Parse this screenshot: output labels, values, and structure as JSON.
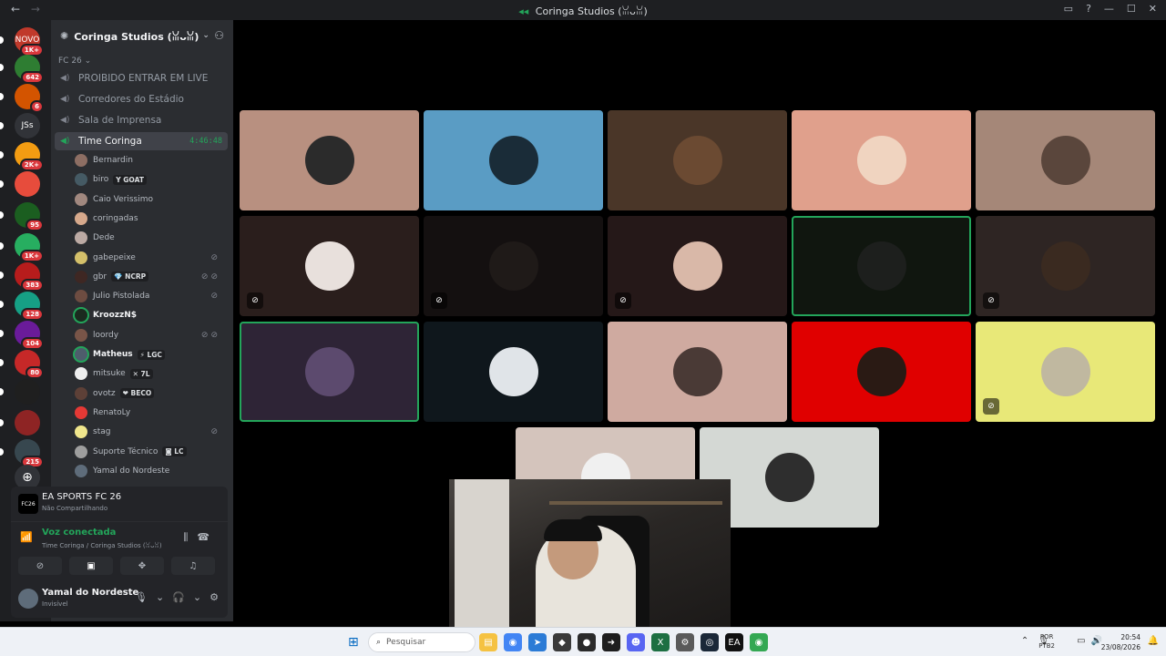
{
  "window": {
    "title": "Coringa Studios (ꈍᴗꈍ)",
    "nav_back": "←",
    "nav_forward": "→"
  },
  "guilds": [
    {
      "label": "NOVO",
      "badge": "1K+",
      "color": "#c0392b"
    },
    {
      "label": "",
      "badge": "642",
      "color": "#2e7d32"
    },
    {
      "label": "",
      "badge": "6",
      "color": "#d35400"
    },
    {
      "label": "JSs",
      "badge": "",
      "color": "#313338"
    },
    {
      "label": "",
      "badge": "2K+",
      "color": "#f39c12"
    },
    {
      "label": "",
      "badge": "",
      "color": "#e74c3c"
    },
    {
      "label": "",
      "badge": "95",
      "color": "#1b5e20"
    },
    {
      "label": "",
      "badge": "1K+",
      "color": "#27ae60"
    },
    {
      "label": "",
      "badge": "383",
      "color": "#b71c1c"
    },
    {
      "label": "",
      "badge": "128",
      "color": "#16a085"
    },
    {
      "label": "",
      "badge": "104",
      "color": "#6a1b9a"
    },
    {
      "label": "",
      "badge": "80",
      "color": "#c62828"
    },
    {
      "label": "",
      "badge": "",
      "color": "#1f1f1f"
    },
    {
      "label": "",
      "badge": "",
      "color": "#8e2424"
    },
    {
      "label": "",
      "badge": "215",
      "color": "#37474f"
    }
  ],
  "server": {
    "name": "Coringa Studios (ꈍᴗꈍ)",
    "category": "FC 26",
    "channels": [
      {
        "name": "PROIBIDO ENTRAR EM LIVE",
        "active": false
      },
      {
        "name": "Corredores do Estádio",
        "active": false
      },
      {
        "name": "Sala de Imprensa",
        "active": false
      },
      {
        "name": "Time Coringa",
        "active": true,
        "timer": "4:46:48"
      }
    ],
    "voice_users": [
      {
        "name": "Bernardin",
        "tag": "",
        "icons": "",
        "bright": false,
        "color": "#8d6e63"
      },
      {
        "name": "biro",
        "tag": "Y GOAT",
        "icons": "",
        "bright": false,
        "color": "#455a64"
      },
      {
        "name": "Caio Verissimo",
        "tag": "",
        "icons": "",
        "bright": false,
        "color": "#a1887f"
      },
      {
        "name": "coringadas",
        "tag": "",
        "icons": "",
        "bright": false,
        "color": "#d7a98c"
      },
      {
        "name": "Dede",
        "tag": "",
        "icons": "",
        "bright": false,
        "color": "#bcaaa4"
      },
      {
        "name": "gabepeixe",
        "tag": "",
        "icons": "⊘",
        "bright": false,
        "color": "#d4c06a"
      },
      {
        "name": "gbr",
        "tag": "💎 NCRP",
        "icons": "⊘⊘",
        "bright": false,
        "color": "#3e2723"
      },
      {
        "name": "Julio Pistolada",
        "tag": "",
        "icons": "⊘",
        "bright": false,
        "color": "#6d4c41"
      },
      {
        "name": "KroozzN$",
        "tag": "",
        "icons": "",
        "bright": true,
        "color": "#1b2a1f",
        "speaking": true
      },
      {
        "name": "loordy",
        "tag": "",
        "icons": "⊘⊘",
        "bright": false,
        "color": "#795548"
      },
      {
        "name": "Matheus",
        "tag": "⚡ LGC",
        "icons": "",
        "bright": true,
        "color": "#4e5d6c",
        "speaking": true
      },
      {
        "name": "mitsuke",
        "tag": "✕ 7L",
        "icons": "",
        "bright": false,
        "color": "#eeeeee"
      },
      {
        "name": "ovotz",
        "tag": "❤ BECO",
        "icons": "",
        "bright": false,
        "color": "#5d4037"
      },
      {
        "name": "RenatoLy",
        "tag": "",
        "icons": "",
        "bright": false,
        "color": "#e53935"
      },
      {
        "name": "stag",
        "tag": "",
        "icons": "⊘",
        "bright": false,
        "color": "#f0e68c"
      },
      {
        "name": "Suporte Técnico",
        "tag": "◙ LC",
        "icons": "",
        "bright": false,
        "color": "#9e9e9e"
      },
      {
        "name": "Yamal do Nordeste",
        "tag": "",
        "icons": "",
        "bright": false,
        "color": "#5e6c7a"
      }
    ]
  },
  "activity": {
    "game": "EA SPORTS FC 26",
    "icon_text": "FC26",
    "status": "Não Compartilhando"
  },
  "voice": {
    "connected": "Voz conectada",
    "location": "Time Coringa / Coringa Studios (ꈍᴗꈍ)"
  },
  "user": {
    "name": "Yamal do Nordeste",
    "status": "Invisível"
  },
  "tiles": [
    {
      "bg": "#b89080",
      "avatar": "#2b2b2b",
      "muted": false,
      "speaking": false
    },
    {
      "bg": "#5a9cc4",
      "avatar": "#1a2c38",
      "muted": false,
      "speaking": false
    },
    {
      "bg": "#4a3628",
      "avatar": "#6b4a32",
      "muted": false,
      "speaking": false
    },
    {
      "bg": "#e0a08c",
      "avatar": "#f0d4c0",
      "muted": false,
      "speaking": false
    },
    {
      "bg": "#a58778",
      "avatar": "#5a463c",
      "muted": false,
      "speaking": false
    },
    {
      "bg": "#2a1e1c",
      "avatar": "#e8e0dc",
      "muted": true,
      "speaking": false
    },
    {
      "bg": "#141010",
      "avatar": "#1f1a18",
      "muted": true,
      "speaking": false
    },
    {
      "bg": "#251818",
      "avatar": "#d9b8a8",
      "muted": true,
      "speaking": false
    },
    {
      "bg": "#10160f",
      "avatar": "#1d1f1d",
      "muted": false,
      "speaking": true
    },
    {
      "bg": "#2e2523",
      "avatar": "#3a2a20",
      "muted": true,
      "speaking": false
    },
    {
      "bg": "#2e2436",
      "avatar": "#5c4a6e",
      "muted": false,
      "speaking": true
    },
    {
      "bg": "#0f171c",
      "avatar": "#e0e4e8",
      "muted": false,
      "speaking": false
    },
    {
      "bg": "#cfaaa0",
      "avatar": "#4a3a36",
      "muted": false,
      "speaking": false
    },
    {
      "bg": "#e00000",
      "avatar": "#2a1a14",
      "muted": false,
      "speaking": false
    },
    {
      "bg": "#e8e878",
      "avatar": "#c0b8a0",
      "muted": true,
      "speaking": false
    },
    {
      "bg": "#d4c4bc",
      "avatar": "#f0f0f0",
      "muted": false,
      "speaking": false
    },
    {
      "bg": "#d4d8d4",
      "avatar": "#2e2e2e",
      "muted": false,
      "speaking": false
    }
  ],
  "taskbar": {
    "search_placeholder": "Pesquisar",
    "lang_top": "POR",
    "lang_bottom": "PTB2",
    "time": "20:54",
    "date": "23/08/2026",
    "apps": [
      {
        "name": "file-explorer",
        "color": "#f5c242",
        "glyph": "▤"
      },
      {
        "name": "chrome",
        "color": "#4285f4",
        "glyph": "◉"
      },
      {
        "name": "app-blue",
        "color": "#2b7bd6",
        "glyph": "➤"
      },
      {
        "name": "app-dark",
        "color": "#3a3a3a",
        "glyph": "◆"
      },
      {
        "name": "app-round",
        "color": "#2a2a2a",
        "glyph": "●"
      },
      {
        "name": "app-arrow",
        "color": "#1e1e1e",
        "glyph": "➜"
      },
      {
        "name": "discord",
        "color": "#5865f2",
        "glyph": "☻"
      },
      {
        "name": "excel",
        "color": "#1d6f42",
        "glyph": "X"
      },
      {
        "name": "settings",
        "color": "#5a5a5a",
        "glyph": "⚙"
      },
      {
        "name": "steam",
        "color": "#1b2838",
        "glyph": "◎"
      },
      {
        "name": "ea-app",
        "color": "#111",
        "glyph": "EA"
      },
      {
        "name": "chrome-2",
        "color": "#34a853",
        "glyph": "◉"
      }
    ]
  }
}
